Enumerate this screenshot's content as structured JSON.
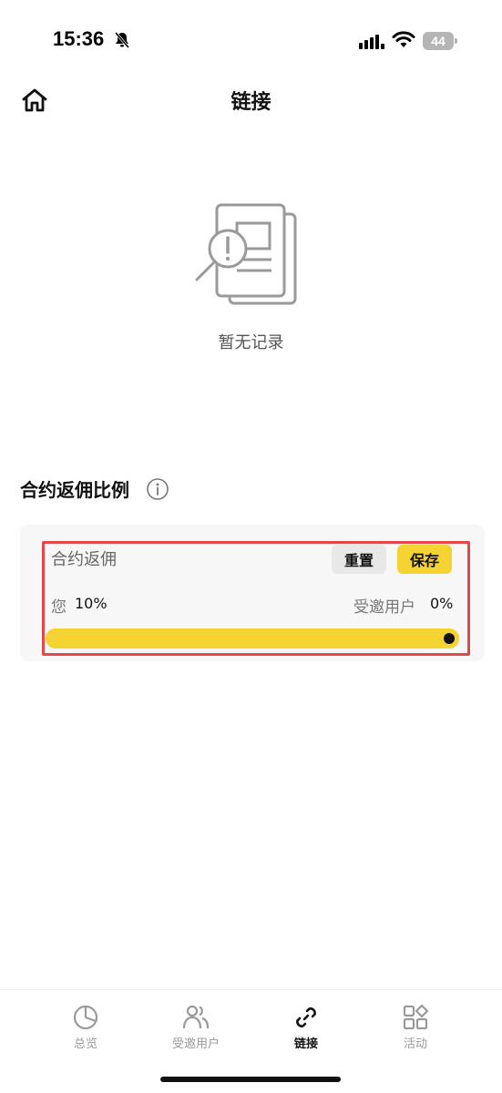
{
  "status_bar": {
    "time": "15:36",
    "battery": "44"
  },
  "header": {
    "title": "链接"
  },
  "empty_state": {
    "text": "暂无记录"
  },
  "rebate_section": {
    "title": "合约返佣比例",
    "row_label": "合约返佣",
    "reset_label": "重置",
    "save_label": "保存",
    "you_label": "您",
    "you_value": "10%",
    "invitee_label": "受邀用户",
    "invitee_value": "0%",
    "slider_fraction": 1.0
  },
  "tabs": [
    {
      "label": "总览",
      "icon": "pie-chart-icon",
      "active": false
    },
    {
      "label": "受邀用户",
      "icon": "users-icon",
      "active": false
    },
    {
      "label": "链接",
      "icon": "link-icon",
      "active": true
    },
    {
      "label": "活动",
      "icon": "apps-grid-icon",
      "active": false
    }
  ],
  "colors": {
    "accent": "#f5d332",
    "highlight_border": "#e3474a",
    "active_tab": "#111111",
    "inactive_tab": "#9a9a9a"
  }
}
